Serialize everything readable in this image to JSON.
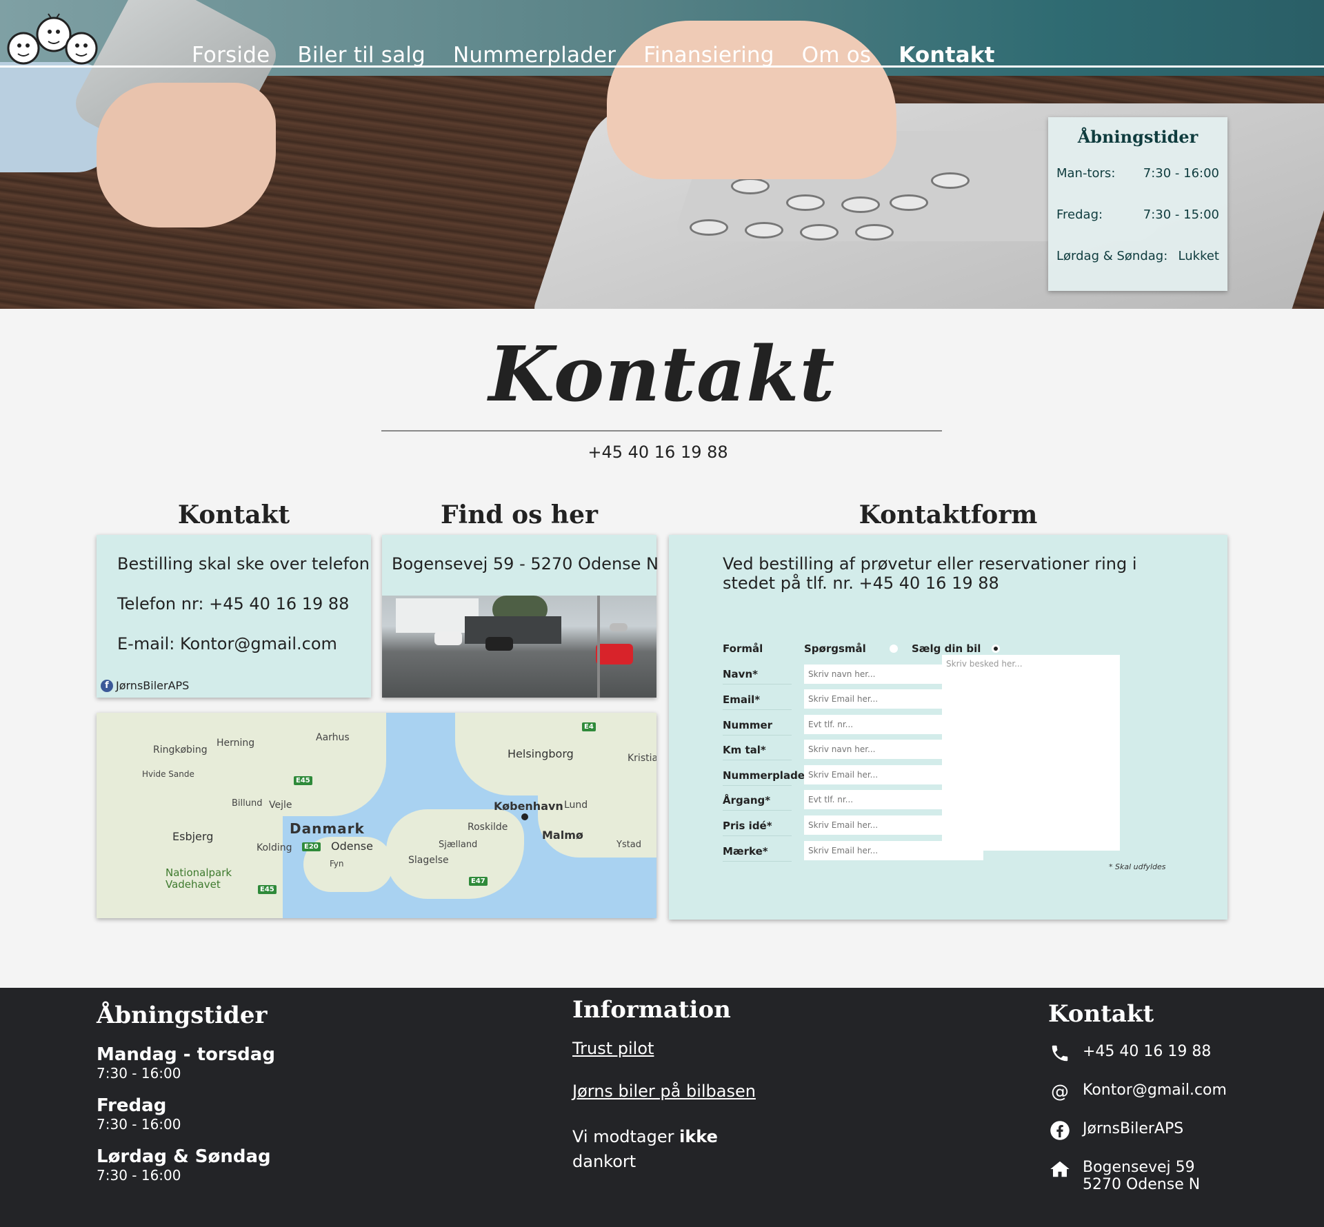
{
  "nav": {
    "items": [
      {
        "label": "Forside",
        "active": false
      },
      {
        "label": "Biler til salg",
        "active": false
      },
      {
        "label": "Nummerplader",
        "active": false
      },
      {
        "label": "Finansiering",
        "active": false
      },
      {
        "label": "Om os",
        "active": false
      },
      {
        "label": "Kontakt",
        "active": true
      }
    ]
  },
  "hero_hours": {
    "title": "Åbningstider",
    "rows": [
      {
        "day": "Man-tors:",
        "time": "7:30 - 16:00"
      },
      {
        "day": "Fredag:",
        "time": "7:30 - 15:00"
      },
      {
        "day": "Lørdag & Søndag:",
        "time": "Lukket"
      }
    ]
  },
  "page": {
    "title": "Kontakt",
    "phone": "+45 40 16 19 88"
  },
  "kontakt": {
    "heading": "Kontakt",
    "line1": "Bestilling skal ske over telefon",
    "line2": "Telefon nr:  +45 40 16 19 88",
    "line3": "E-mail: Kontor@gmail.com",
    "facebook": "JørnsBilerAPS"
  },
  "find": {
    "heading": "Find os her",
    "address": "Bogensevej 59 - 5270 Odense N"
  },
  "map": {
    "labels": [
      "Herning",
      "Aarhus",
      "Ringkøbing",
      "Hvide Sande",
      "Helsingborg",
      "Kristia",
      "Billund",
      "Vejle",
      "Danmark",
      "København",
      "Lund",
      "Roskilde",
      "Malmø",
      "Esbjerg",
      "Kolding",
      "Odense",
      "Sjælland",
      "Slagelse",
      "Fyn",
      "Ystad",
      "Nationalpark\nVadehavet"
    ],
    "shields": [
      "E45",
      "E20",
      "E45",
      "E47",
      "E4"
    ]
  },
  "form": {
    "heading": "Kontaktform",
    "intro": "Ved bestilling af prøvetur eller reservationer ring i stedet på tlf. nr. +45 40 16 19 88",
    "purpose_label": "Formål",
    "option1": "Spørgsmål",
    "option2": "Sælg din bil",
    "selected": "Sælg din bil",
    "fields": [
      {
        "label": "Navn*",
        "placeholder": "Skriv navn her..."
      },
      {
        "label": "Email*",
        "placeholder": "Skriv Email her..."
      },
      {
        "label": "Nummer",
        "placeholder": "Evt tlf. nr..."
      },
      {
        "label": "Km tal*",
        "placeholder": "Skriv navn her..."
      },
      {
        "label": "Nummerplade*",
        "placeholder": "Skriv Email her..."
      },
      {
        "label": "Årgang*",
        "placeholder": "Evt tlf. nr..."
      },
      {
        "label": "Pris idé*",
        "placeholder": "Skriv Email her..."
      },
      {
        "label": "Mærke*",
        "placeholder": "Skriv Email her..."
      }
    ],
    "message_placeholder": "Skriv besked her...",
    "required_note": "* Skal udfyldes"
  },
  "footer": {
    "hours_heading": "Åbningstider",
    "hours": [
      {
        "day": "Mandag - torsdag",
        "time": "7:30 - 16:00"
      },
      {
        "day": "Fredag",
        "time": "7:30 - 16:00"
      },
      {
        "day": "Lørdag & Søndag",
        "time": "7:30 - 16:00"
      }
    ],
    "info_heading": "Information",
    "link1": "Trust pilot",
    "link2": "Jørns biler på bilbasen",
    "dankort_pre": "Vi modtager ",
    "dankort_bold": "ikke",
    "dankort_post": "dankort",
    "contact_heading": "Kontakt",
    "phone": "+45 40 16 19 88",
    "email": "Kontor@gmail.com",
    "facebook": "JørnsBilerAPS",
    "address1": "Bogensevej 59",
    "address2": "5270 Odense N"
  },
  "colors": {
    "card_bg": "#d3ecea",
    "footer_bg": "#232427",
    "page_bg": "#f4f4f4",
    "accent_dark": "#0f3c3e"
  }
}
